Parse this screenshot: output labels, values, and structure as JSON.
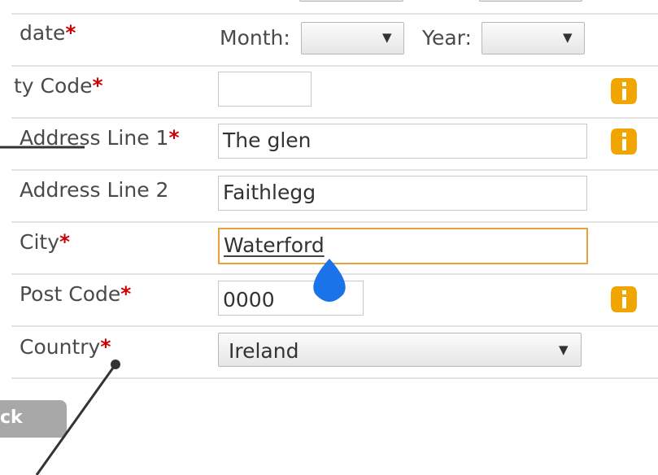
{
  "form": {
    "dob": {
      "label": "date",
      "month_label": "Month:",
      "year_label": "Year:",
      "month_value": "",
      "year_value": ""
    },
    "security_code": {
      "label": "ty Code",
      "value": ""
    },
    "address1": {
      "label": "Address Line 1",
      "value": "The glen"
    },
    "address2": {
      "label": "Address Line 2",
      "value": "Faithlegg"
    },
    "city": {
      "label": "City",
      "value": "Waterford"
    },
    "postcode": {
      "label": "Post Code",
      "value": "0000"
    },
    "country": {
      "label": "Country",
      "value": "Ireland"
    },
    "required_mark": "*",
    "back_button": "ck",
    "dropdown_arrow": "▼"
  },
  "colors": {
    "required": "#cc0000",
    "info_icon": "#f0a500",
    "focus_border": "#e8a23a",
    "text_handle": "#1a73e8"
  }
}
